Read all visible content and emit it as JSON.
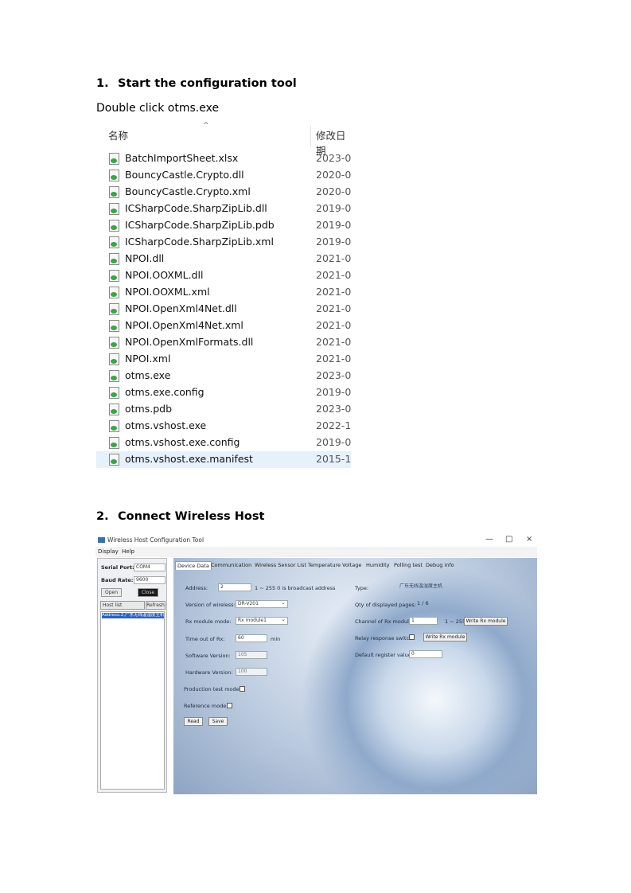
{
  "section1": {
    "number": "1.",
    "title": "Start the configuration tool",
    "instruction": "Double click otms.exe"
  },
  "explorer": {
    "col_name": "名称",
    "col_date": "修改日期",
    "files": [
      {
        "name": "BatchImportSheet.xlsx",
        "date": "2023-0"
      },
      {
        "name": "BouncyCastle.Crypto.dll",
        "date": "2020-0"
      },
      {
        "name": "BouncyCastle.Crypto.xml",
        "date": "2020-0"
      },
      {
        "name": "ICSharpCode.SharpZipLib.dll",
        "date": "2019-0"
      },
      {
        "name": "ICSharpCode.SharpZipLib.pdb",
        "date": "2019-0"
      },
      {
        "name": "ICSharpCode.SharpZipLib.xml",
        "date": "2019-0"
      },
      {
        "name": "NPOI.dll",
        "date": "2021-0"
      },
      {
        "name": "NPOI.OOXML.dll",
        "date": "2021-0"
      },
      {
        "name": "NPOI.OOXML.xml",
        "date": "2021-0"
      },
      {
        "name": "NPOI.OpenXml4Net.dll",
        "date": "2021-0"
      },
      {
        "name": "NPOI.OpenXml4Net.xml",
        "date": "2021-0"
      },
      {
        "name": "NPOI.OpenXmlFormats.dll",
        "date": "2021-0"
      },
      {
        "name": "NPOI.xml",
        "date": "2021-0"
      },
      {
        "name": "otms.exe",
        "date": "2023-0"
      },
      {
        "name": "otms.exe.config",
        "date": "2019-0"
      },
      {
        "name": "otms.pdb",
        "date": "2023-0"
      },
      {
        "name": "otms.vshost.exe",
        "date": "2022-1"
      },
      {
        "name": "otms.vshost.exe.config",
        "date": "2019-0"
      },
      {
        "name": "otms.vshost.exe.manifest",
        "date": "2015-1"
      }
    ]
  },
  "section2": {
    "number": "2.",
    "title": "Connect Wireless Host"
  },
  "app": {
    "title": "Wireless Host Configuration Tool",
    "window_controls": {
      "minimize": "—",
      "maximize": "□",
      "close": "×"
    },
    "menu": [
      "Display",
      "Help"
    ],
    "left": {
      "serial_port_label": "Serial Port:",
      "serial_port_value": "COM4",
      "baud_rate_label": "Baud Rate:",
      "baud_rate_value": "9600",
      "open": "Open",
      "close": "Close",
      "host_list": "Host list",
      "refresh": "Refresh",
      "list_item": "Address:2,广东无线温湿度主机"
    },
    "tabs": [
      "Device Data",
      "Communication",
      "Wireless Sensor List",
      "Temperature",
      "Voltage",
      "Humidity",
      "Polling test",
      "Debug info"
    ],
    "fields": {
      "address_label": "Address:",
      "address_value": "2",
      "address_hint": "1 ~ 255 0 is broadcast address",
      "version_label": "Version of wireless:",
      "version_value": "DR-V201",
      "rx_mode_label": "Rx module mode:",
      "rx_mode_value": "Rx module1",
      "timeout_label": "Time out of Rx:",
      "timeout_value": "60",
      "timeout_unit": "min",
      "software_label": "Software Version:",
      "software_value": "105",
      "hardware_label": "Hardware Version:",
      "hardware_value": "100",
      "production_label": "Production test mode",
      "reference_label": "Reference mode",
      "read": "Read",
      "save": "Save",
      "type_label": "Type:",
      "type_value": "广东无线温湿度主机",
      "qty_label": "Qty of displayed pages:",
      "qty_value": "1 / 6",
      "channel_label": "Channel of Rx module:",
      "channel_value": "1",
      "channel_hint": "1 ~ 255",
      "write_rx": "Write Rx module",
      "relay_label": "Relay response switch",
      "write_rx_module": "Write Rx module",
      "default_reg_label": "Default register value:",
      "default_reg_value": "0"
    }
  }
}
